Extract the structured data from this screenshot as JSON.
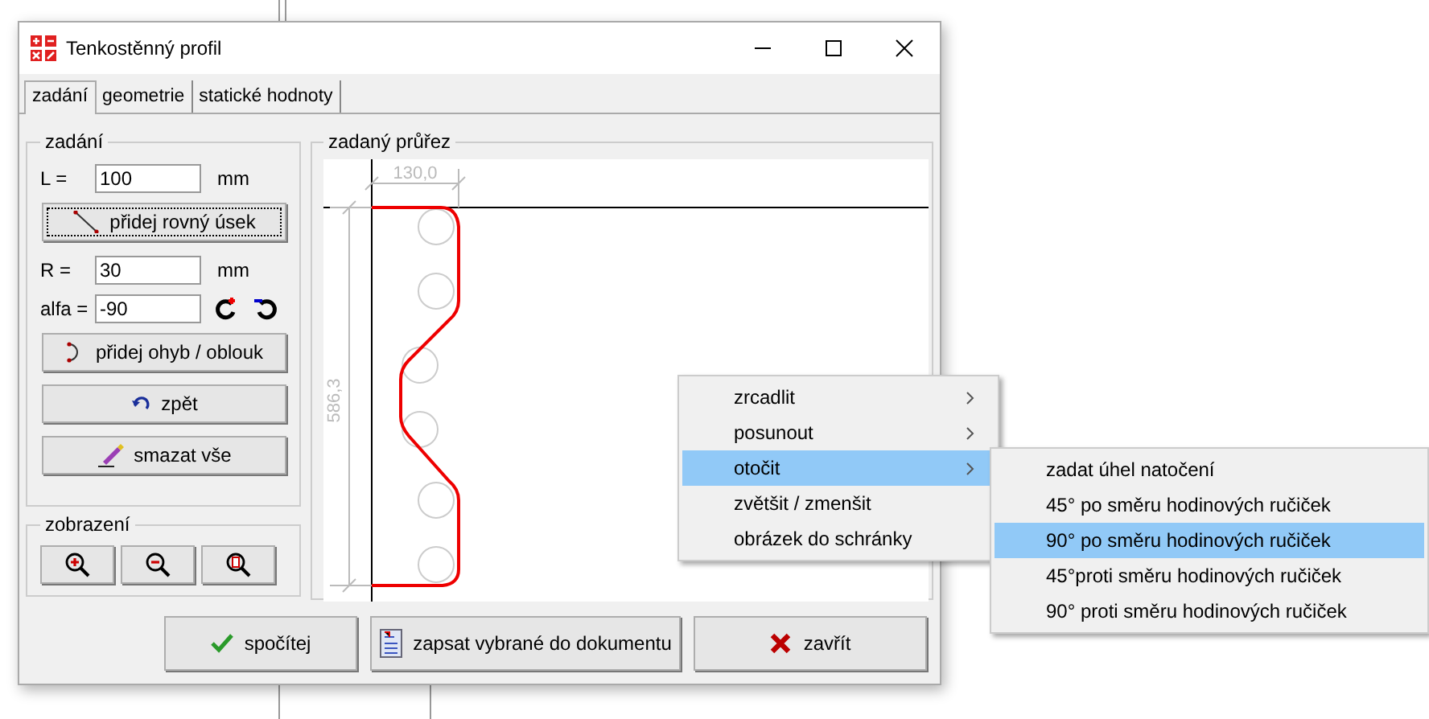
{
  "window": {
    "title": "Tenkostěnný profil"
  },
  "tabs": [
    {
      "label": "zadání",
      "selected": true
    },
    {
      "label": "geometrie",
      "selected": false
    },
    {
      "label": "statické hodnoty",
      "selected": false
    }
  ],
  "input_group": {
    "title": "zadání",
    "length": {
      "label": "L =",
      "value": "100",
      "unit": "mm"
    },
    "add_straight_button": {
      "label": "přidej rovný úsek",
      "focused": true
    },
    "radius": {
      "label": "R =",
      "value": "30",
      "unit": "mm"
    },
    "angle": {
      "label": "alfa =",
      "value": "-90"
    },
    "add_bend_button": {
      "label": "přidej ohyb / oblouk",
      "focused": false
    },
    "undo_button": {
      "label": "zpět",
      "focused": false
    },
    "clear_button": {
      "label": "smazat vše",
      "focused": false
    }
  },
  "view_group": {
    "title": "zobrazení"
  },
  "section_group": {
    "title": "zadaný průřez",
    "width_dimension": "130,0",
    "height_dimension": "586,3"
  },
  "context_menu": {
    "items": [
      {
        "label": "zrcadlit",
        "selected": false,
        "has_submenu": true
      },
      {
        "label": "posunout",
        "selected": false,
        "has_submenu": true
      },
      {
        "label": "otočit",
        "selected": true,
        "has_submenu": true
      },
      {
        "label": "zvětšit / zmenšit",
        "selected": false,
        "has_submenu": false
      },
      {
        "label": "obrázek do schránky",
        "selected": false,
        "has_submenu": false
      }
    ]
  },
  "submenu": {
    "items": [
      {
        "label": "zadat úhel natočení",
        "selected": false
      },
      {
        "label": "45° po směru hodinových ručiček",
        "selected": false
      },
      {
        "label": "90° po směru hodinových ručiček",
        "selected": true
      },
      {
        "label": "45°proti směru hodinových ručiček",
        "selected": false
      },
      {
        "label": "90° proti směru hodinových ručiček",
        "selected": false
      }
    ]
  },
  "buttons": [
    {
      "label": "spočítej",
      "kind": "check"
    },
    {
      "label": "zapsat vybrané do dokumentu",
      "kind": "document"
    },
    {
      "label": "zavřít",
      "kind": "close"
    }
  ]
}
